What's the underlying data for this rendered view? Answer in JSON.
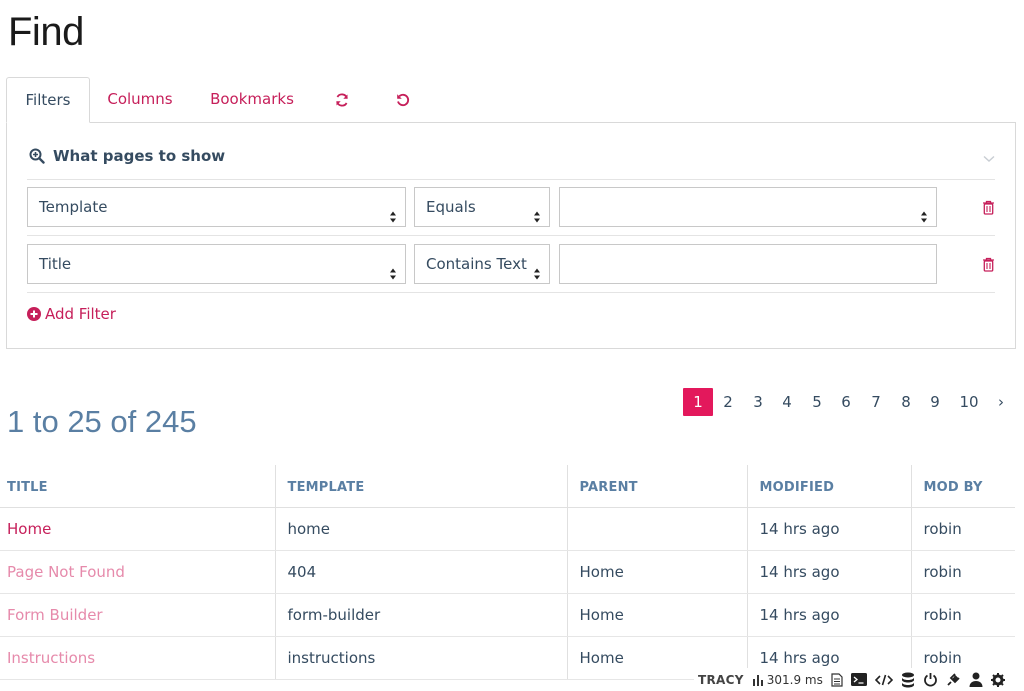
{
  "page": {
    "title": "Find"
  },
  "tabs": [
    {
      "label": "Filters",
      "active": true
    },
    {
      "label": "Columns"
    },
    {
      "label": "Bookmarks"
    },
    {
      "icon": "refresh-icon"
    },
    {
      "icon": "undo-icon"
    }
  ],
  "filters_panel": {
    "heading": "What pages to show",
    "heading_icon": "zoom-search-icon",
    "rows": [
      {
        "field": "Template",
        "operator": "Equals",
        "value": ""
      },
      {
        "field": "Title",
        "operator": "Contains Text",
        "value": ""
      }
    ],
    "add_filter_label": "Add Filter"
  },
  "results": {
    "summary": "1 to 25 of 245",
    "pagination": {
      "pages": [
        "1",
        "2",
        "3",
        "4",
        "5",
        "6",
        "7",
        "8",
        "9",
        "10"
      ],
      "current": "1",
      "next": "›"
    },
    "columns": [
      "TITLE",
      "TEMPLATE",
      "PARENT",
      "MODIFIED",
      "MOD BY"
    ],
    "rows": [
      {
        "title": "Home",
        "template": "home",
        "parent": "",
        "modified": "14 hrs ago",
        "mod_by": "robin"
      },
      {
        "title": "Page Not Found",
        "template": "404",
        "parent": "Home",
        "modified": "14 hrs ago",
        "mod_by": "robin"
      },
      {
        "title": "Form Builder",
        "template": "form-builder",
        "parent": "Home",
        "modified": "14 hrs ago",
        "mod_by": "robin"
      },
      {
        "title": "Instructions",
        "template": "instructions",
        "parent": "Home",
        "modified": "14 hrs ago",
        "mod_by": "robin"
      }
    ]
  },
  "tracy_bar": {
    "brand": "TRACY",
    "time": "301.9 ms"
  },
  "colors": {
    "accent": "#e3185c",
    "link": "#c61f5a",
    "text": "#354b60",
    "muted_blue": "#5a7fa3"
  }
}
